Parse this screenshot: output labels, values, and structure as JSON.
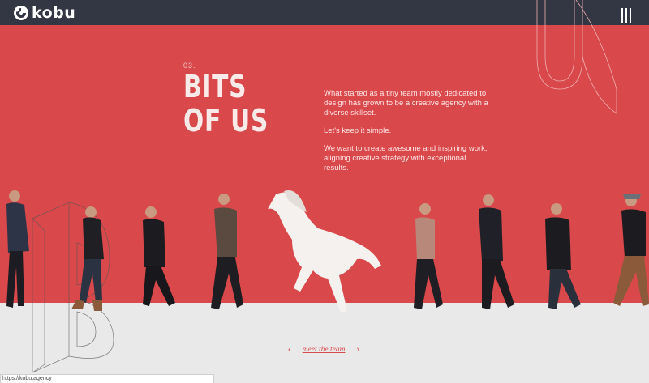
{
  "header": {
    "brand": "kobu",
    "menu_icon": "hamburger-icon"
  },
  "section": {
    "number": "03.",
    "title_line1": "BITS",
    "title_line2": "OF US"
  },
  "intro": {
    "paragraph1": "What started as a tiny team mostly dedicated to design has grown to be a creative agency with a diverse skillset.",
    "paragraph2": "Let's keep it simple.",
    "paragraph3": "We want to create awesome and inspiring work, aligning creative strategy with exceptional results."
  },
  "team_nav": {
    "link_label": "meet the team",
    "prev_icon": "chevron-left-icon",
    "next_icon": "chevron-right-icon"
  },
  "status_bar": {
    "url": "https://kobu.agency"
  },
  "colors": {
    "brand_red": "#d9484a",
    "header_dark": "#333744",
    "floor": "#e9e9e9"
  }
}
